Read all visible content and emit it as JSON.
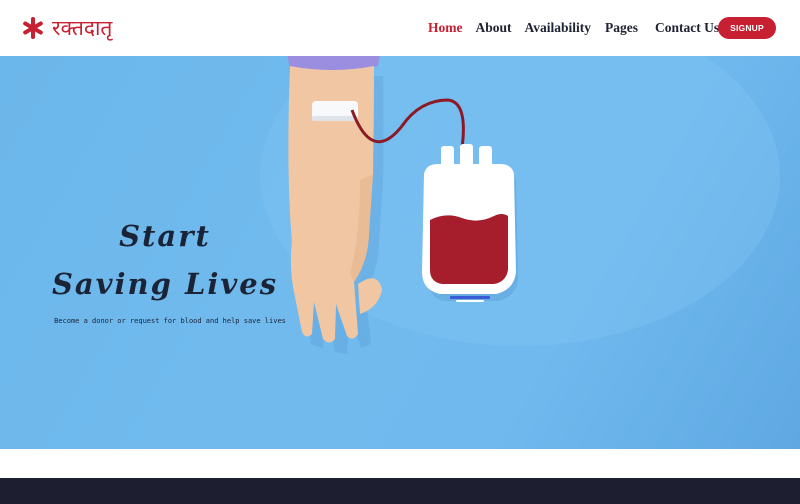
{
  "brand": {
    "name": "रक्तदातृ",
    "icon": "asterisk-icon",
    "color": "#c62032"
  },
  "nav": {
    "items": [
      {
        "label": "Home",
        "active": true
      },
      {
        "label": "About",
        "active": false
      },
      {
        "label": "Availability",
        "active": false
      },
      {
        "label": "Pages",
        "active": false
      },
      {
        "label": "Contact Us",
        "active": false
      }
    ],
    "signup_label": "SIGNUP",
    "active_color": "#c62032",
    "text_color": "#1e2233"
  },
  "hero": {
    "title_line1": "Start",
    "title_line2": "Saving Lives",
    "subtitle": "Become a donor or request for blood and help save lives",
    "background_color": "#6fb9ef",
    "illustration": "arm-with-blood-bag-illustration"
  },
  "footer": {
    "band_color": "#1d1f30"
  }
}
